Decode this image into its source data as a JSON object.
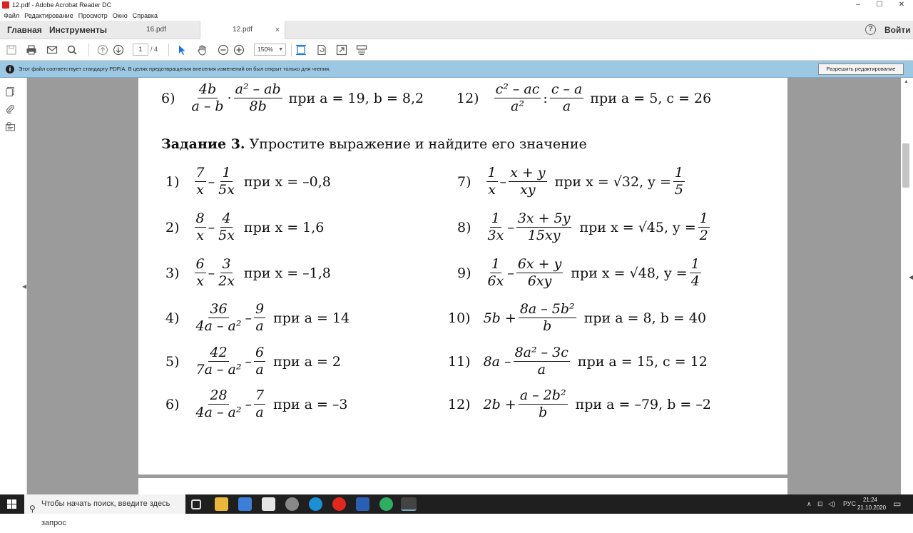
{
  "window": {
    "title": "12.pdf - Adobe Acrobat Reader DC",
    "minimize": "–",
    "maximize": "☐",
    "close": "✕"
  },
  "menu": [
    "Файл",
    "Редактирование",
    "Просмотр",
    "Окно",
    "Справка"
  ],
  "tabs": {
    "home": "Главная",
    "tools": "Инструменты",
    "doc1": "16.pdf",
    "doc2": "12.pdf",
    "close": "×",
    "help": "?",
    "login": "Войти"
  },
  "toolbar": {
    "page_current": "1",
    "page_total": "/ 4",
    "zoom": "150%"
  },
  "infobar": {
    "text": "Этот файл соответствует стандарту PDF/A. В целях предотвращения внесения изменений он был открыт только для чтения.",
    "button": "Разрешить редактирование"
  },
  "document": {
    "prev_left": {
      "num": "6)",
      "f1n": "4b",
      "f1d": "a – b",
      "dot": "·",
      "f2n": "a² – ab",
      "f2d": "8b",
      "cond": "при a = 19, b = 8,2"
    },
    "prev_right": {
      "num": "12)",
      "f1n": "c² – ac",
      "f1d": "a²",
      "colon": ":",
      "f2n": "c – a",
      "f2d": "a",
      "cond": "при a = 5, c = 26"
    },
    "heading_bold": "Задание 3.",
    "heading_rest": " Упростите выражение и найдите его значение",
    "left": [
      {
        "num": "1)",
        "f1n": "7",
        "f1d": "x",
        "op": "–",
        "f2n": "1",
        "f2d": "5x",
        "cond": "при x = –0,8"
      },
      {
        "num": "2)",
        "f1n": "8",
        "f1d": "x",
        "op": "–",
        "f2n": "4",
        "f2d": "5x",
        "cond": "при x = 1,6"
      },
      {
        "num": "3)",
        "f1n": "6",
        "f1d": "x",
        "op": "–",
        "f2n": "3",
        "f2d": "2x",
        "cond": "при x = –1,8"
      },
      {
        "num": "4)",
        "f1n": "36",
        "f1d": "4a – a²",
        "op": "–",
        "f2n": "9",
        "f2d": "a",
        "cond": "при a = 14"
      },
      {
        "num": "5)",
        "f1n": "42",
        "f1d": "7a – a²",
        "op": "–",
        "f2n": "6",
        "f2d": "a",
        "cond": "при a = 2"
      },
      {
        "num": "6)",
        "f1n": "28",
        "f1d": "4a – a²",
        "op": "–",
        "f2n": "7",
        "f2d": "a",
        "cond": "при a = –3"
      }
    ],
    "right": [
      {
        "num": "7)",
        "f1n": "1",
        "f1d": "x",
        "op": "–",
        "f2n": "x + y",
        "f2d": "xy",
        "cond": "при x = √32, y =",
        "f3n": "1",
        "f3d": "5"
      },
      {
        "num": "8)",
        "f1n": "1",
        "f1d": "3x",
        "op": "–",
        "f2n": "3x + 5y",
        "f2d": "15xy",
        "cond": "при x = √45, y =",
        "f3n": "1",
        "f3d": "2"
      },
      {
        "num": "9)",
        "f1n": "1",
        "f1d": "6x",
        "op": "–",
        "f2n": "6x + y",
        "f2d": "6xy",
        "cond": "при x = √48, y =",
        "f3n": "1",
        "f3d": "4"
      },
      {
        "num": "10)",
        "pre": "5b +",
        "f2n": "8a – 5b²",
        "f2d": "b",
        "cond": "при a = 8, b = 40"
      },
      {
        "num": "11)",
        "pre": "8a –",
        "f2n": "8a² – 3c",
        "f2d": "a",
        "cond": "при a = 15, c = 12"
      },
      {
        "num": "12)",
        "pre": "2b +",
        "f2n": "a – 2b²",
        "f2d": "b",
        "cond": "при a = –79, b = –2"
      }
    ]
  },
  "taskbar": {
    "search": "Чтобы начать поиск, введите здесь запрос",
    "lang": "РУС",
    "time": "21:24",
    "date": "21.10.2020"
  }
}
